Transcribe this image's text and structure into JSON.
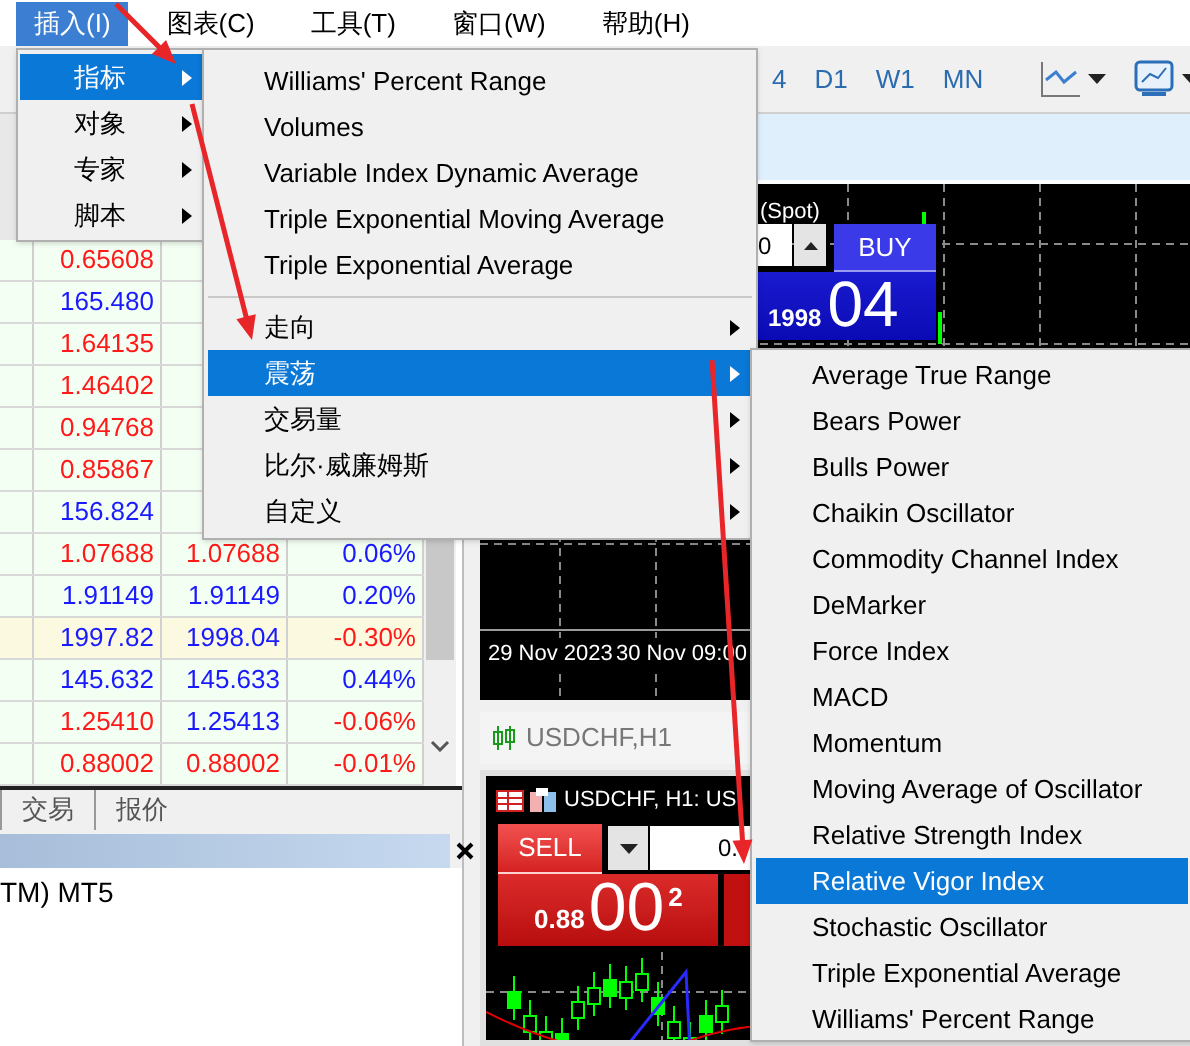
{
  "menu_bar": {
    "items": [
      {
        "label": "插入(I)",
        "selected": true
      },
      {
        "label": "图表(C)",
        "selected": false
      },
      {
        "label": "工具(T)",
        "selected": false
      },
      {
        "label": "窗口(W)",
        "selected": false
      },
      {
        "label": "帮助(H)",
        "selected": false
      }
    ]
  },
  "insert_menu": {
    "items": [
      {
        "label": "指标",
        "selected": true
      },
      {
        "label": "对象",
        "selected": false
      },
      {
        "label": "专家",
        "selected": false
      },
      {
        "label": "脚本",
        "selected": false
      }
    ]
  },
  "indicator_menu": {
    "items": [
      {
        "kind": "item",
        "label": "Williams' Percent Range",
        "selected": false
      },
      {
        "kind": "item",
        "label": "Volumes",
        "selected": false
      },
      {
        "kind": "item",
        "label": "Variable Index Dynamic Average",
        "selected": false
      },
      {
        "kind": "item",
        "label": "Triple Exponential Moving Average",
        "selected": false
      },
      {
        "kind": "item",
        "label": "Triple Exponential Average",
        "selected": false
      },
      {
        "kind": "separator"
      },
      {
        "kind": "submenu",
        "label": "走向",
        "selected": false
      },
      {
        "kind": "submenu",
        "label": "震荡",
        "selected": true
      },
      {
        "kind": "submenu",
        "label": "交易量",
        "selected": false
      },
      {
        "kind": "submenu",
        "label": "比尔·威廉姆斯",
        "selected": false
      },
      {
        "kind": "submenu",
        "label": "自定义",
        "selected": false
      }
    ]
  },
  "oscillator_menu": {
    "items": [
      {
        "label": "Average True Range",
        "selected": false
      },
      {
        "label": "Bears Power",
        "selected": false
      },
      {
        "label": "Bulls Power",
        "selected": false
      },
      {
        "label": "Chaikin Oscillator",
        "selected": false
      },
      {
        "label": "Commodity Channel Index",
        "selected": false
      },
      {
        "label": "DeMarker",
        "selected": false
      },
      {
        "label": "Force Index",
        "selected": false
      },
      {
        "label": "MACD",
        "selected": false
      },
      {
        "label": "Momentum",
        "selected": false
      },
      {
        "label": "Moving Average of Oscillator",
        "selected": false
      },
      {
        "label": "Relative Strength Index",
        "selected": false
      },
      {
        "label": "Relative Vigor Index",
        "selected": true
      },
      {
        "label": "Stochastic Oscillator",
        "selected": false
      },
      {
        "label": "Triple Exponential Average",
        "selected": false
      },
      {
        "label": "Williams' Percent Range",
        "selected": false
      }
    ]
  },
  "toolbar": {
    "timeframes": [
      "4",
      "D1",
      "W1",
      "MN"
    ]
  },
  "market_watch": {
    "rows": [
      {
        "highlighted": false,
        "cells": [
          {
            "text": "0.65608",
            "color": "#ff1a1a"
          }
        ]
      },
      {
        "highlighted": false,
        "cells": [
          {
            "text": "165.480",
            "color": "#1a1aff"
          }
        ]
      },
      {
        "highlighted": false,
        "cells": [
          {
            "text": "1.64135",
            "color": "#ff1a1a"
          }
        ]
      },
      {
        "highlighted": false,
        "cells": [
          {
            "text": "1.46402",
            "color": "#ff1a1a"
          }
        ]
      },
      {
        "highlighted": false,
        "cells": [
          {
            "text": "0.94768",
            "color": "#ff1a1a"
          }
        ]
      },
      {
        "highlighted": false,
        "cells": [
          {
            "text": "0.85867",
            "color": "#ff1a1a"
          }
        ]
      },
      {
        "highlighted": false,
        "cells": [
          {
            "text": "156.824",
            "color": "#1a1aff"
          }
        ]
      },
      {
        "highlighted": false,
        "cells": [
          {
            "text": "1.07688",
            "color": "#ff1a1a"
          },
          {
            "text": "1.07688",
            "color": "#ff1a1a"
          },
          {
            "text": "0.06%",
            "color": "#1a1aff"
          }
        ]
      },
      {
        "highlighted": false,
        "cells": [
          {
            "text": "1.91149",
            "color": "#1a1aff"
          },
          {
            "text": "1.91149",
            "color": "#1a1aff"
          },
          {
            "text": "0.20%",
            "color": "#1a1aff"
          }
        ]
      },
      {
        "highlighted": true,
        "cells": [
          {
            "text": "1997.82",
            "color": "#1a1aff"
          },
          {
            "text": "1998.04",
            "color": "#1a1aff"
          },
          {
            "text": "-0.30%",
            "color": "#ff1a1a"
          }
        ]
      },
      {
        "highlighted": false,
        "cells": [
          {
            "text": "145.632",
            "color": "#1a1aff"
          },
          {
            "text": "145.633",
            "color": "#1a1aff"
          },
          {
            "text": "0.44%",
            "color": "#1a1aff"
          }
        ]
      },
      {
        "highlighted": false,
        "cells": [
          {
            "text": "1.25410",
            "color": "#ff1a1a"
          },
          {
            "text": "1.25413",
            "color": "#1a1aff"
          },
          {
            "text": "-0.06%",
            "color": "#ff1a1a"
          }
        ]
      },
      {
        "highlighted": false,
        "cells": [
          {
            "text": "0.88002",
            "color": "#ff1a1a"
          },
          {
            "text": "0.88002",
            "color": "#ff1a1a"
          },
          {
            "text": "-0.01%",
            "color": "#ff1a1a"
          }
        ]
      }
    ]
  },
  "bottom_tabs": [
    "交易",
    "报价"
  ],
  "panel": {
    "text": "TM) MT5"
  },
  "chart_top": {
    "label": "(Spot)",
    "volume_field": "0",
    "buy_label": "BUY",
    "price_small": "1998",
    "price_big": "04",
    "dates": [
      "29 Nov 2023",
      "30 Nov 09:00"
    ]
  },
  "chart_bottom": {
    "title": "USDCHF,H1",
    "header": "USDCHF, H1: US",
    "sell_label": "SELL",
    "volume_field": "0.",
    "price_small": "0.88",
    "price_big": "00",
    "price_sup": "2"
  }
}
